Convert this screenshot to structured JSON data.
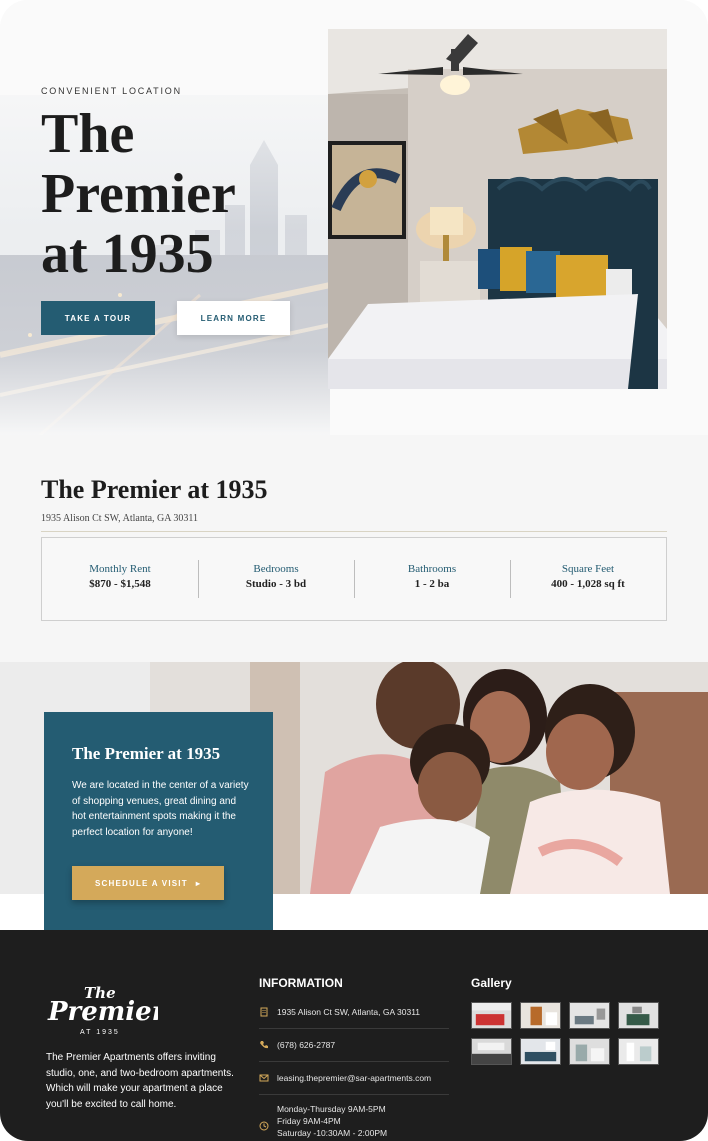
{
  "hero": {
    "eyebrow": "CONVENIENT LOCATION",
    "title_line1": "The",
    "title_line2": "Premier",
    "title_line3": "at 1935",
    "tour_button": "TAKE A TOUR",
    "learn_button": "LEARN MORE"
  },
  "property": {
    "name": "The Premier at 1935",
    "address": "1935 Alison Ct SW, Atlanta, GA 30311",
    "stats": [
      {
        "label": "Monthly Rent",
        "value": "$870 - $1,548"
      },
      {
        "label": "Bedrooms",
        "value": "Studio - 3 bd"
      },
      {
        "label": "Bathrooms",
        "value": "1 - 2 ba"
      },
      {
        "label": "Square Feet",
        "value": "400 - 1,028 sq ft"
      }
    ]
  },
  "about": {
    "title": "The Premier at 1935",
    "text": "We are located in the center of a variety of shopping venues, great dining and hot entertainment spots making it the perfect location for anyone!",
    "button": "SCHEDULE A VISIT",
    "button_arrow": "▸"
  },
  "footer": {
    "logo_the": "The",
    "logo_premier": "Premier",
    "logo_at": "AT 1935",
    "description": "The Premier Apartments offers inviting studio, one, and two-bedroom apartments. Which will make your apartment a place you'll be excited to call home.",
    "info_heading": "INFORMATION",
    "address": "1935 Alison Ct SW, Atlanta, GA 30311",
    "phone": "(678) 626-2787",
    "email": "leasing.thepremier@sar-apartments.com",
    "hours": [
      "Monday-Thursday 9AM-5PM",
      "Friday 9AM-4PM",
      "Saturday -10:30AM - 2:00PM"
    ],
    "gallery_heading": "Gallery",
    "icons": [
      "building-icon",
      "phone-icon",
      "mail-icon",
      "clock-icon"
    ]
  },
  "colors": {
    "accent_teal": "#245c72",
    "accent_gold": "#d4a95a",
    "footer_bg": "#1e1e1e"
  }
}
